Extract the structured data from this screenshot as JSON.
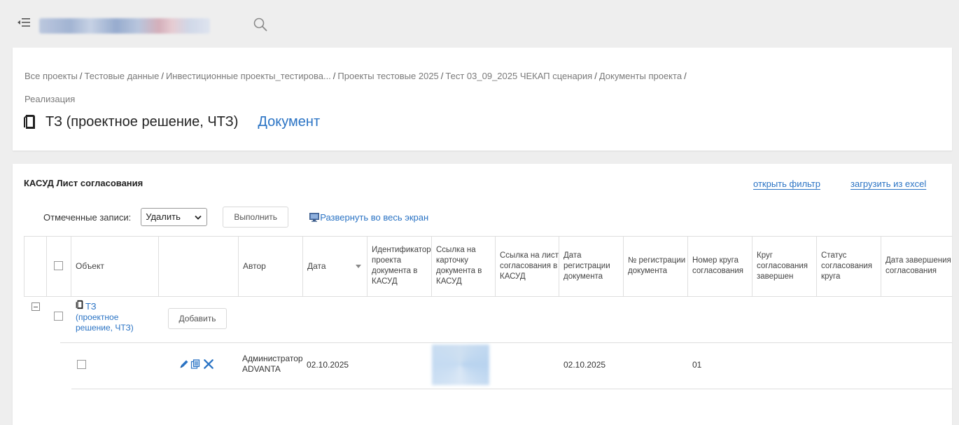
{
  "breadcrumb": {
    "items": [
      "Все проекты",
      "Тестовые данные",
      "Инвестиционные проекты_тестирова...",
      "Проекты тестовые 2025",
      "Тест 03_09_2025 ЧЕКАП сценария",
      "Документы проекта",
      "Реализация"
    ],
    "separator": "/"
  },
  "header": {
    "title": "ТЗ (проектное решение, ЧТЗ)",
    "doc_type": "Документ"
  },
  "section": {
    "title": "КАСУД Лист согласования",
    "open_filter": "открыть фильтр",
    "load_excel": "загрузить из excel"
  },
  "toolbar": {
    "marked_label": "Отмеченные записи:",
    "action_value": "Удалить",
    "execute_label": "Выполнить",
    "expand_label": "Развернуть во весь экран"
  },
  "table": {
    "columns": [
      "Объект",
      "",
      "Автор",
      "Дата",
      "Идентификатор проекта документа в КАСУД",
      "Ссылка на карточку документа в КАСУД",
      "Ссылка на лист согласования в КАСУД",
      "Дата регистрации документа",
      "№ регистрации документа",
      "Номер круга согласования",
      "Круг согласования завершен",
      "Статус согласования круга",
      "Дата завершения согласования"
    ],
    "group": {
      "object_prefix": "ТЗ",
      "object_rest": "(проектное решение, ЧТЗ)",
      "add_label": "Добавить"
    },
    "rows": [
      {
        "author": "Администратор ADVANTA",
        "date": "02.10.2025",
        "reg_date": "02.10.2025",
        "round_number": "01"
      }
    ]
  },
  "colors": {
    "link": "#2a73c4",
    "background": "#eeeeee",
    "card": "#ffffff",
    "grid_line": "#dedede"
  }
}
